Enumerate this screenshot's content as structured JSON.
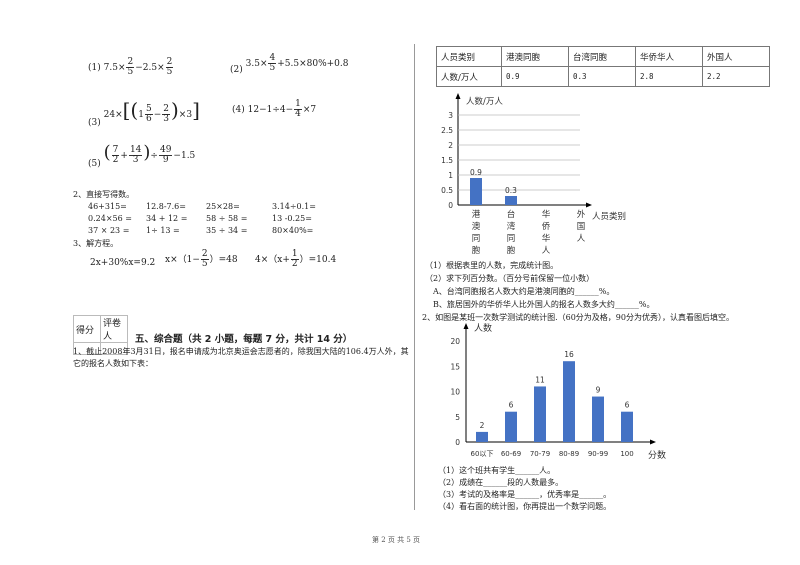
{
  "calc": {
    "items": [
      {
        "label": "(1)",
        "a": "7.5×",
        "f1n": "2",
        "f1d": "5",
        "b": "−2.5×",
        "f2n": "2",
        "f2d": "5"
      },
      {
        "label": "(2)",
        "a": "3.5×",
        "fn": "4",
        "fd": "5",
        "b": "+5.5×80%+0.8"
      },
      {
        "label": "(3)",
        "a": "24×",
        "b": "1",
        "f1n": "5",
        "f1d": "6",
        "c": "−",
        "f2n": "2",
        "f2d": "3",
        "d": "×3"
      },
      {
        "label": "(4)",
        "a": "12−1÷4−",
        "fn": "1",
        "fd": "4",
        "b": "×7"
      },
      {
        "label": "(5)",
        "f1n": "7",
        "f1d": "2",
        "plus": "+",
        "f2n": "14",
        "f2d": "3",
        "div": "÷",
        "f3n": "49",
        "f3d": "9",
        "tail": "−1.5"
      }
    ]
  },
  "oral": {
    "heading": "2、直接写得数。",
    "rows": [
      [
        "46+315=",
        "12.8-7.6=",
        "25×28=",
        "3.14÷0.1="
      ],
      [
        "0.24×56 =",
        "34 + 12 =",
        "58 ÷ 58 =",
        "13 -0.25="
      ],
      [
        "37 × 23 =",
        "1÷ 13 =",
        "35 ÷ 34 =",
        "80×40%="
      ]
    ]
  },
  "equations": {
    "heading": "3、解方程。",
    "eq1": "2x+30%x=9.2",
    "eq2a": "x×（1−",
    "eq2fn": "2",
    "eq2fd": "5",
    "eq2b": "）=48",
    "eq3a": "4×（x+",
    "eq3fn": "1",
    "eq3fd": "2",
    "eq3b": "）=10.4"
  },
  "score_box": {
    "score": "得分",
    "reviewer": "评卷人"
  },
  "section5": {
    "title": "五、综合题（共 2 小题，每题 7 分，共计 14 分）",
    "q1_line1": "1、截止2008年3月31日，报名申请成为北京奥运会志愿者的，除我国大陆的106.4万人外，其",
    "q1_line2": "它的报名人数如下表："
  },
  "volunteer_table": {
    "header": [
      "人员类别",
      "港澳同胞",
      "台湾同胞",
      "华侨华人",
      "外国人"
    ],
    "row": [
      "人数/万人",
      "0.9",
      "0.3",
      "2.8",
      "2.2"
    ]
  },
  "q1_questions": [
    "（1）根据表里的人数，完成统计图。",
    "（2）求下列百分数。（百分号前保留一位小数）",
    "A、台湾同胞报名人数大约是港澳同胞的______%。",
    "B、旅居国外的华侨华人比外国人的报名人数多大约______%。"
  ],
  "q2_intro": "2、如图是某班一次数学测试的统计图.（60分为及格，90分为优秀），认真看图后填空。",
  "q2_questions": [
    "（1）这个班共有学生______人。",
    "（2）成绩在______段的人数最多。",
    "（3）考试的及格率是______，优秀率是______。",
    "（4）看右面的统计图，你再提出一个数学问题。"
  ],
  "footer": "第 2 页 共 5 页",
  "chart_data": [
    {
      "type": "bar",
      "title": "",
      "ylabel": "人数/万人",
      "xlabel": "人员类别",
      "categories": [
        "港澳同胞",
        "台湾同胞",
        "华侨华人",
        "外国人"
      ],
      "category_labels_vertical": [
        [
          "港",
          "澳",
          "同",
          "胞"
        ],
        [
          "台",
          "湾",
          "同",
          "胞"
        ],
        [
          "华",
          "侨",
          "华",
          "人"
        ],
        [
          "外",
          "国",
          "人"
        ]
      ],
      "values": [
        0.9,
        0.3,
        null,
        null
      ],
      "data_labels": [
        "0.9",
        "0.3",
        "",
        ""
      ],
      "yticks": [
        "0",
        "0.5",
        "1",
        "1.5",
        "2",
        "2.5",
        "3"
      ],
      "ylim": [
        0,
        3
      ],
      "grid": true,
      "bar_color": "#4472c4"
    },
    {
      "type": "bar",
      "title": "",
      "ylabel": "人数",
      "xlabel": "分数",
      "categories": [
        "60以下",
        "60-69",
        "70-79",
        "80-89",
        "90-99",
        "100"
      ],
      "values": [
        2,
        6,
        11,
        16,
        9,
        6
      ],
      "data_labels": [
        "2",
        "6",
        "11",
        "16",
        "9",
        "6"
      ],
      "yticks": [
        "0",
        "5",
        "10",
        "15",
        "20"
      ],
      "ylim": [
        0,
        20
      ],
      "grid": false,
      "bar_color": "#4472c4"
    }
  ]
}
